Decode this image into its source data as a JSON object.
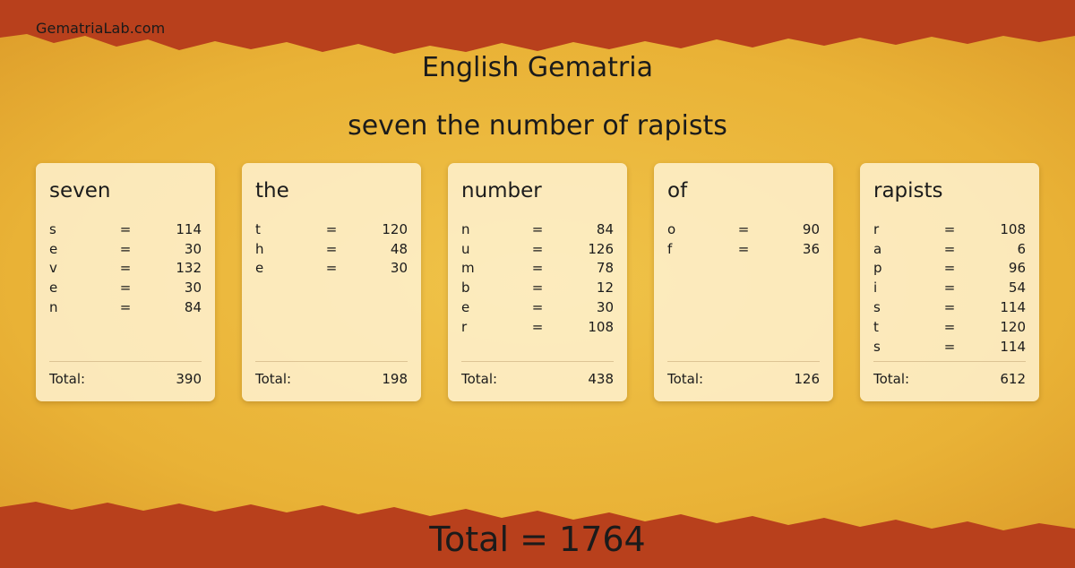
{
  "site": {
    "name": "GematriaLab.com"
  },
  "title": "English Gematria",
  "phrase": "seven the number of rapists",
  "colors": {
    "band": "#b8401c",
    "parchment": "#ecb83c",
    "card": "#fff4d7"
  },
  "words": [
    {
      "word": "seven",
      "letters": [
        {
          "letter": "s",
          "value": "114"
        },
        {
          "letter": "e",
          "value": "30"
        },
        {
          "letter": "v",
          "value": "132"
        },
        {
          "letter": "e",
          "value": "30"
        },
        {
          "letter": "n",
          "value": "84"
        }
      ],
      "total_label": "Total:",
      "total": "390"
    },
    {
      "word": "the",
      "letters": [
        {
          "letter": "t",
          "value": "120"
        },
        {
          "letter": "h",
          "value": "48"
        },
        {
          "letter": "e",
          "value": "30"
        }
      ],
      "total_label": "Total:",
      "total": "198"
    },
    {
      "word": "number",
      "letters": [
        {
          "letter": "n",
          "value": "84"
        },
        {
          "letter": "u",
          "value": "126"
        },
        {
          "letter": "m",
          "value": "78"
        },
        {
          "letter": "b",
          "value": "12"
        },
        {
          "letter": "e",
          "value": "30"
        },
        {
          "letter": "r",
          "value": "108"
        }
      ],
      "total_label": "Total:",
      "total": "438"
    },
    {
      "word": "of",
      "letters": [
        {
          "letter": "o",
          "value": "90"
        },
        {
          "letter": "f",
          "value": "36"
        }
      ],
      "total_label": "Total:",
      "total": "126"
    },
    {
      "word": "rapists",
      "letters": [
        {
          "letter": "r",
          "value": "108"
        },
        {
          "letter": "a",
          "value": "6"
        },
        {
          "letter": "p",
          "value": "96"
        },
        {
          "letter": "i",
          "value": "54"
        },
        {
          "letter": "s",
          "value": "114"
        },
        {
          "letter": "t",
          "value": "120"
        },
        {
          "letter": "s",
          "value": "114"
        }
      ],
      "total_label": "Total:",
      "total": "612"
    }
  ],
  "grand_total": "Total = 1764"
}
